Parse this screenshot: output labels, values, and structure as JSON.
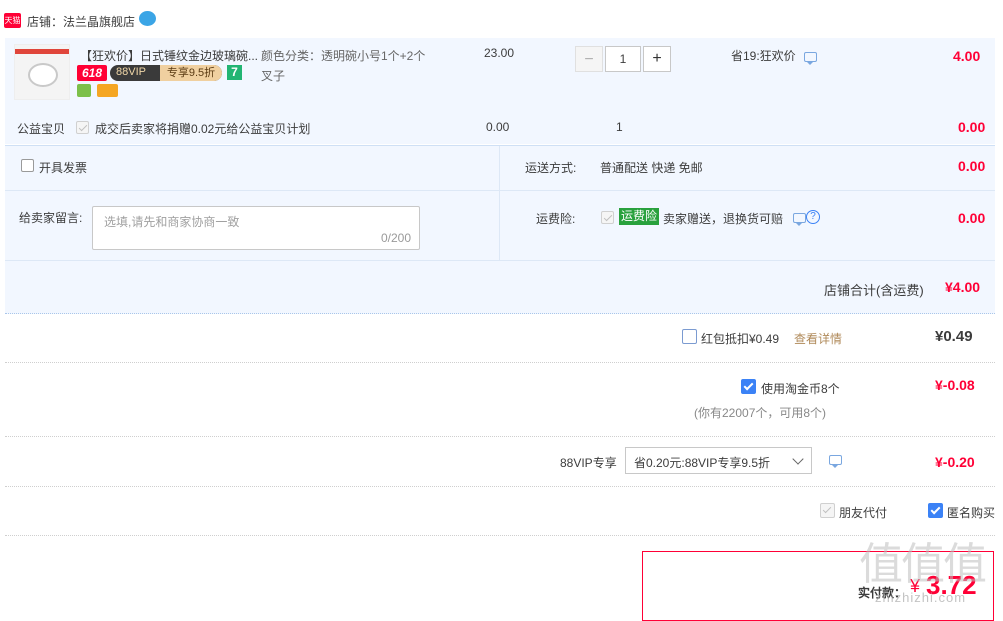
{
  "store": {
    "badge": "天猫",
    "label": "店铺：法兰晶旗舰店"
  },
  "item": {
    "title": "【狂欢价】日式锤纹金边玻璃碗...",
    "promo_618": "618",
    "promo_88vip": "88VIP",
    "promo_discount": "专享9.5折",
    "promo_7": "7",
    "sku_label": "颜色分类：透明碗小号1个+2个",
    "sku_label2": "叉子",
    "price": "23.00",
    "qty": "1",
    "minus": "−",
    "plus": "+",
    "saving": "省19:狂欢价",
    "subtotal": "4.00"
  },
  "charity": {
    "label": "公益宝贝",
    "text": "成交后卖家将捐赠0.02元给公益宝贝计划",
    "price": "0.00",
    "qty": "1",
    "subtotal": "0.00"
  },
  "invoice": {
    "label": "开具发票"
  },
  "shipping": {
    "label": "运送方式:",
    "value": "普通配送 快递 免邮",
    "price": "0.00"
  },
  "message": {
    "label": "给卖家留言:",
    "placeholder": "选填,请先和商家协商一致",
    "counter": "0/200"
  },
  "insurance": {
    "label": "运费险:",
    "tag": "运费险",
    "text": "卖家赠送，退换货可赔",
    "help": "?",
    "price": "0.00"
  },
  "store_total": {
    "label": "店铺合计(含运费)",
    "value": "¥4.00"
  },
  "redpacket": {
    "label": "红包抵扣¥0.49",
    "link": "查看详情",
    "value": "¥0.49"
  },
  "coins": {
    "label": "使用淘金币8个",
    "note": "(你有22007个，可用8个)",
    "value": "¥-0.08"
  },
  "vip": {
    "label": "88VIP专享",
    "select": "省0.20元:88VIP专享9.5折",
    "value": "¥-0.20"
  },
  "options": {
    "friend_pay": "朋友代付",
    "anonymous": "匿名购买"
  },
  "pay": {
    "label": "实付款：",
    "currency": "¥",
    "amount": "3.72"
  },
  "watermark": {
    "text": "值值值",
    "url": "zhizhizhi.com"
  },
  "colors": {
    "accent_red": "#ff0036",
    "bg_blue": "#f2f7ff",
    "link_blue": "#3b82f6"
  }
}
